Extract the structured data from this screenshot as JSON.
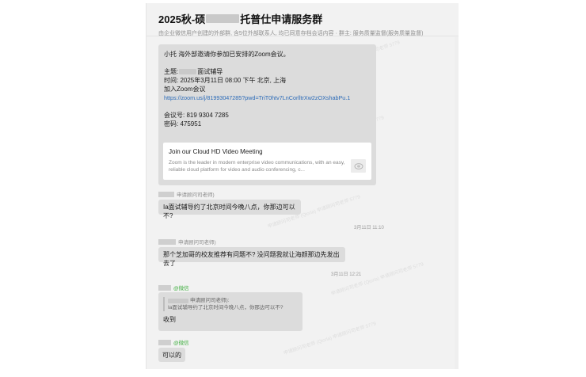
{
  "chat": {
    "title_prefix": "2025秋-硕",
    "title_suffix": "托普仕申请服务群",
    "subtitle": "由企业微信用户创建的外部群, 含5位外部联系人, 均已同意存档会话内容 · 群主: 服务质量监督(服务质量监督)"
  },
  "messages": {
    "zoom": {
      "line1": "小托 海外部邀请你参加已安排的Zoom会议。",
      "topic_prefix": "主题:",
      "topic_suffix": "面试辅导",
      "time": "时间: 2025年3月11日 08:00 下午 北京, 上海",
      "join": "加入Zoom会议",
      "link": "https://zoom.us/j/81993047285?pwd=TriT0htv7LnCorlltrXw2zOXshabPu.1",
      "meeting_id": "会议号: 819 9304 7285",
      "password": "密码: 475951",
      "card_title": "Join our Cloud HD Video Meeting",
      "card_desc": "Zoom is the leader in modern enterprise video communications, with an easy, reliable cloud platform for video and audio conferencing, c..."
    },
    "msg2": {
      "sender": "申请顾问司老师)",
      "text": "Ia面试辅导约了北京时间今晚八点，你那边可以不?",
      "time": "3月11日 11:10"
    },
    "msg3": {
      "sender": "申请顾问司老师)",
      "text": "那个芝加哥的校友推荐有问题不? 没问题我就让海颜那边先发出去了",
      "time": "3月11日 12:21"
    },
    "msg4": {
      "sender_tag": "@微信",
      "quote_sender": "申请顾问司老师):",
      "quote_text": "Ia面试辅导约了北京时间今晚八点，你那边可以不?",
      "text": "收到"
    },
    "msg5": {
      "sender_tag": "@微信",
      "text": "可以的"
    }
  },
  "watermark": "申请顾问司老师 (Qiorla) 申请顾问司老师 5779"
}
